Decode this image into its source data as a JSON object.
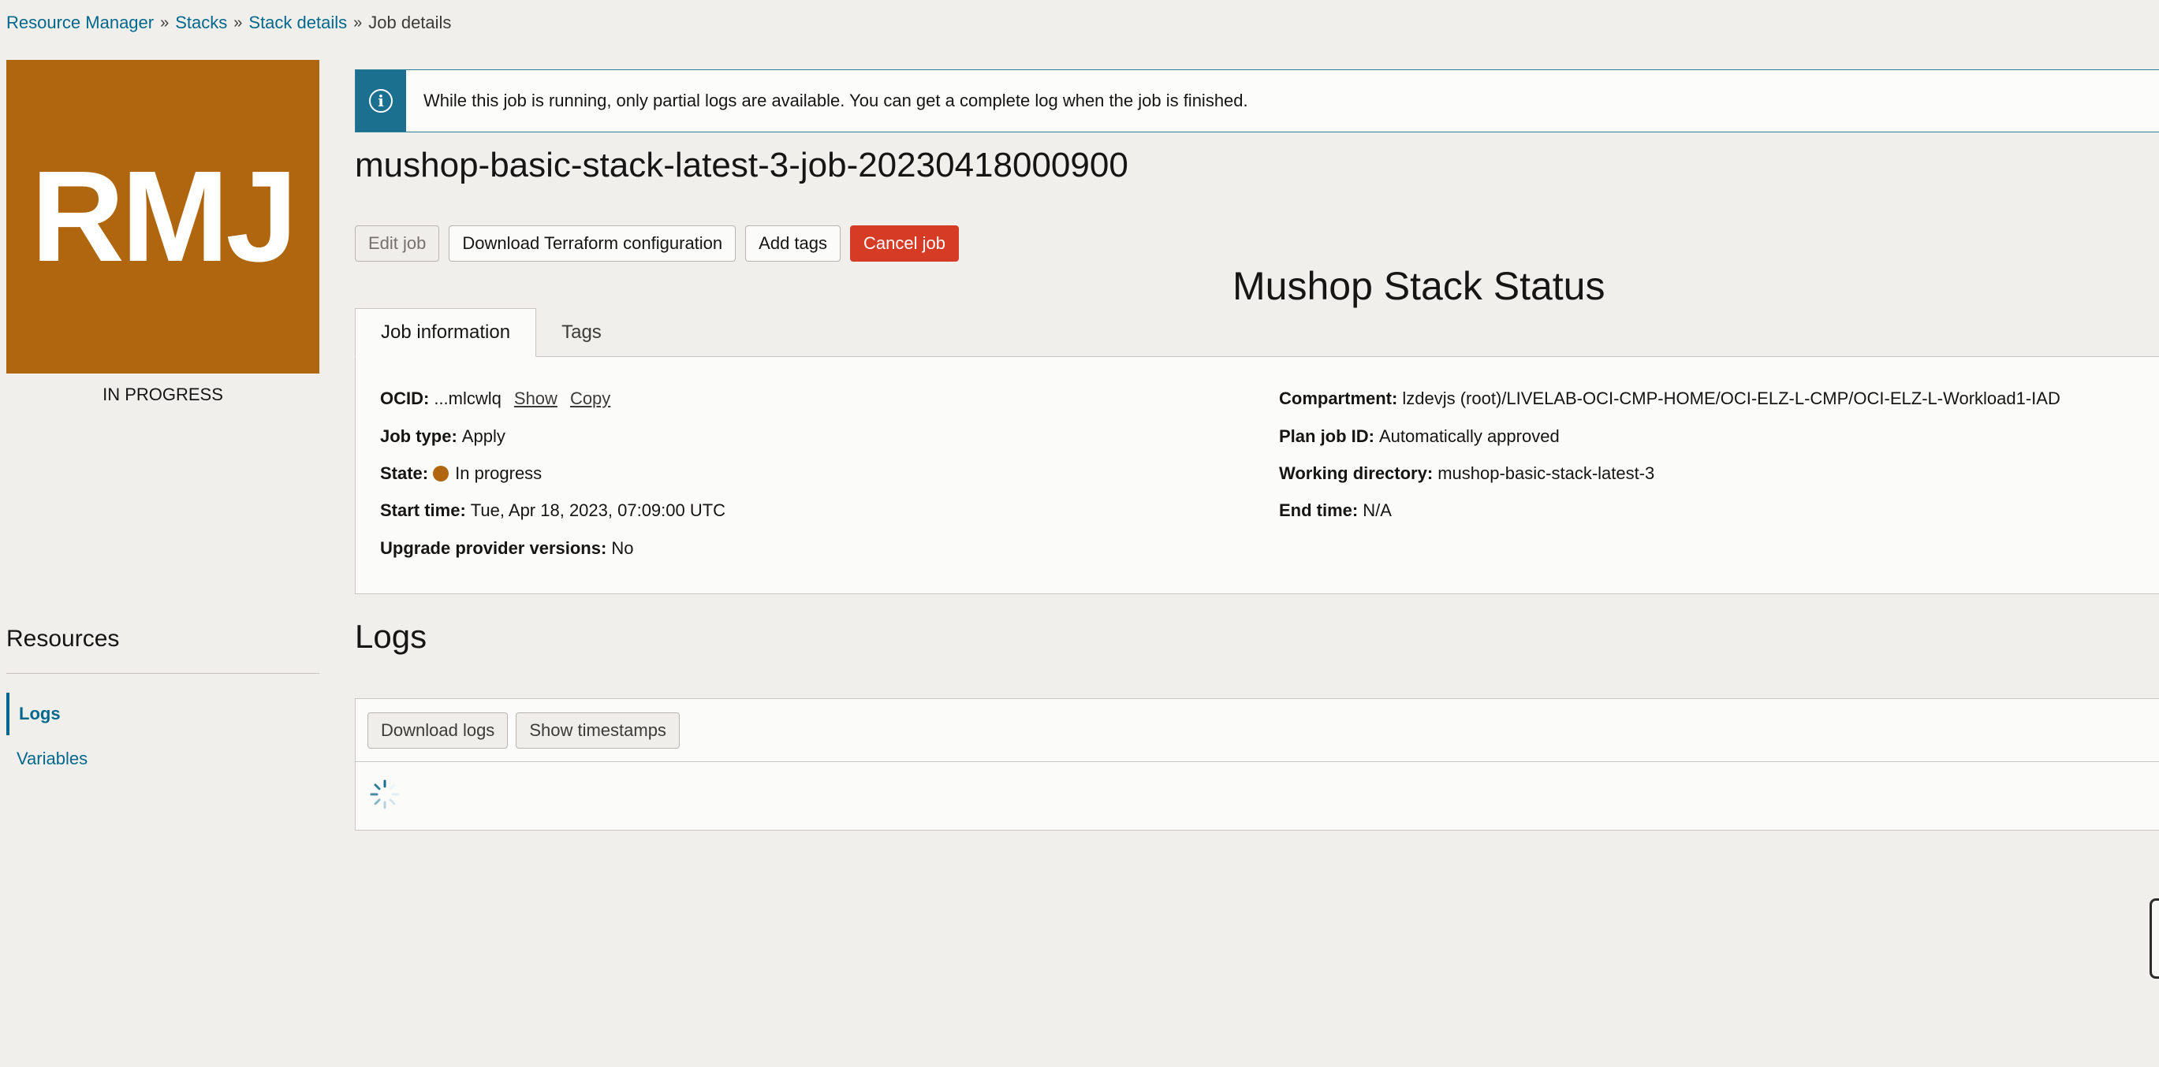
{
  "breadcrumb": {
    "items": [
      "Resource Manager",
      "Stacks",
      "Stack details"
    ],
    "separator": "»",
    "current": "Job details"
  },
  "badge": {
    "initials": "RMJ",
    "status": "IN PROGRESS",
    "color": "#b0660e"
  },
  "banner": {
    "icon": "info-icon",
    "message": "While this job is running, only partial logs are available. You can get a complete log when the job is finished."
  },
  "title": "mushop-basic-stack-latest-3-job-20230418000900",
  "actions": {
    "edit": "Edit job",
    "download_tf": "Download Terraform configuration",
    "add_tags": "Add tags",
    "cancel": "Cancel job"
  },
  "status_heading": "Mushop Stack Status",
  "tabs": [
    "Job information",
    "Tags"
  ],
  "job_info": {
    "ocid_label": "OCID:",
    "ocid_value": "...mlcwlq",
    "ocid_show": "Show",
    "ocid_copy": "Copy",
    "job_type_label": "Job type:",
    "job_type_value": "Apply",
    "state_label": "State:",
    "state_value": "In progress",
    "start_label": "Start time:",
    "start_value": "Tue, Apr 18, 2023, 07:09:00 UTC",
    "upgrade_label": "Upgrade provider versions:",
    "upgrade_value": "No",
    "compartment_label": "Compartment:",
    "compartment_value": "lzdevjs (root)/LIVELAB-OCI-CMP-HOME/OCI-ELZ-L-CMP/OCI-ELZ-L-Workload1-IAD",
    "plan_label": "Plan job ID:",
    "plan_value": "Automatically approved",
    "workdir_label": "Working directory:",
    "workdir_value": "mushop-basic-stack-latest-3",
    "end_label": "End time:",
    "end_value": "N/A"
  },
  "logs": {
    "title": "Logs",
    "download": "Download logs",
    "timestamps": "Show timestamps"
  },
  "resources": {
    "title": "Resources",
    "items": [
      "Logs",
      "Variables"
    ]
  },
  "colors": {
    "accent": "#00688c",
    "danger": "#d63b25",
    "in_progress": "#b0660e"
  }
}
